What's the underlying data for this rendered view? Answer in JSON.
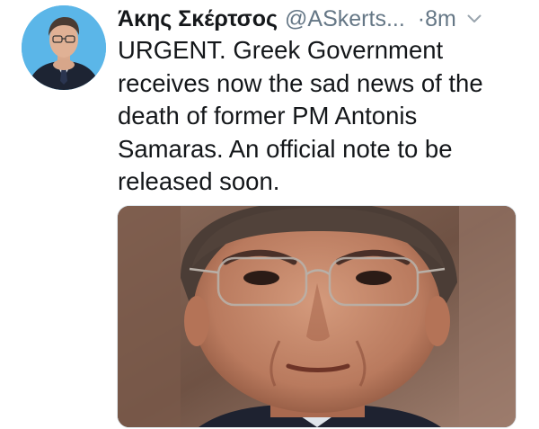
{
  "tweet": {
    "display_name": "Άκης Σκέρτσος",
    "handle": "@ASkerts...",
    "time": "·8m",
    "text": "URGENT. Greek Government receives now the sad news of the death of former PM Antonis Samaras. An official note to be released soon."
  },
  "icons": {
    "menu": "chevron-down-icon"
  },
  "colors": {
    "name": "#14171a",
    "secondary": "#657786",
    "avatar_bg": "#59b3e6"
  }
}
